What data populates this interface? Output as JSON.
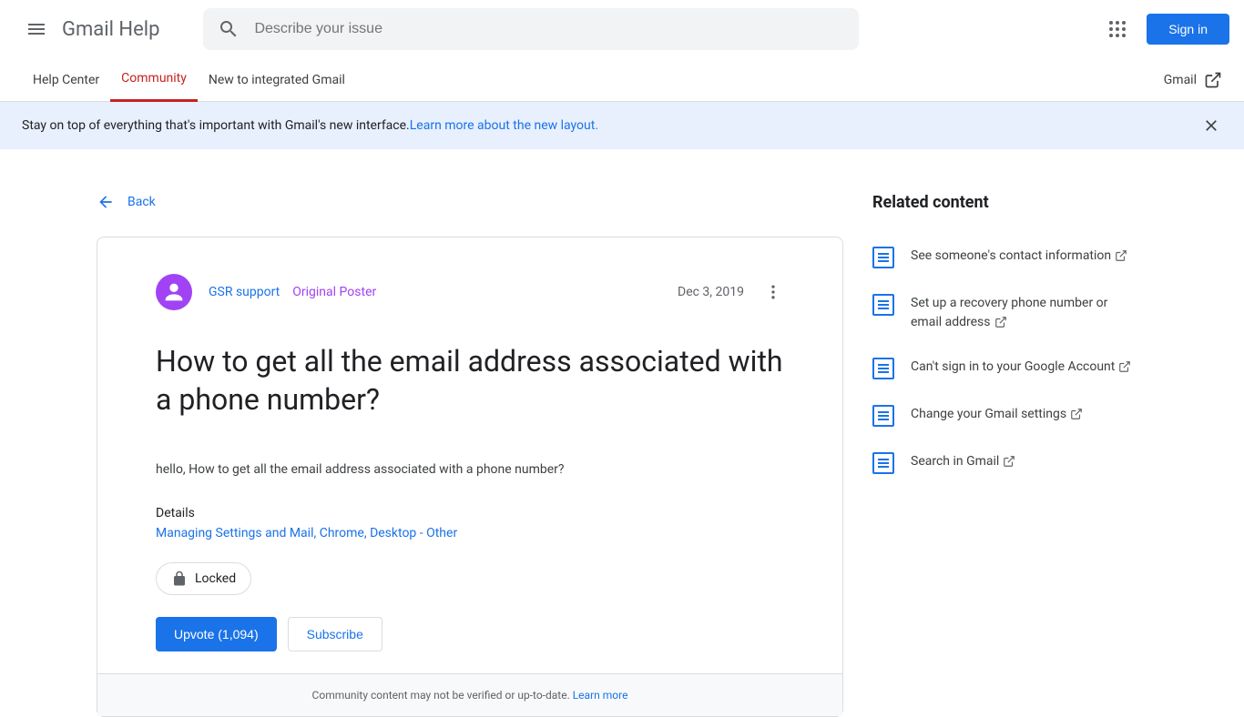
{
  "header": {
    "title": "Gmail Help",
    "search_placeholder": "Describe your issue",
    "signin_label": "Sign in"
  },
  "tabs": {
    "help_center": "Help Center",
    "community": "Community",
    "new_gmail": "New to integrated Gmail",
    "gmail_link": "Gmail"
  },
  "banner": {
    "text": "Stay on top of everything that's important with Gmail's new interface. ",
    "link_text": "Learn more about the new layout."
  },
  "back_label": "Back",
  "post": {
    "author": "GSR support",
    "badge": "Original Poster",
    "date": "Dec 3, 2019",
    "title": "How to get all the email address associated with a phone number?",
    "body": "hello, How to get all the email address associated with a phone number?",
    "details_label": "Details",
    "tag1": "Managing Settings and Mail",
    "tag2": "Chrome",
    "tag3": "Desktop - Other",
    "locked_label": "Locked",
    "upvote_label": "Upvote (1,094)",
    "subscribe_label": "Subscribe",
    "footer_text": "Community content may not be verified or up-to-date. ",
    "footer_link": "Learn more"
  },
  "sidebar": {
    "title": "Related content",
    "items": [
      {
        "text": "See someone's contact information"
      },
      {
        "text": "Set up a recovery phone number or email address"
      },
      {
        "text": "Can't sign in to your Google Account"
      },
      {
        "text": "Change your Gmail settings"
      },
      {
        "text": "Search in Gmail"
      }
    ]
  }
}
